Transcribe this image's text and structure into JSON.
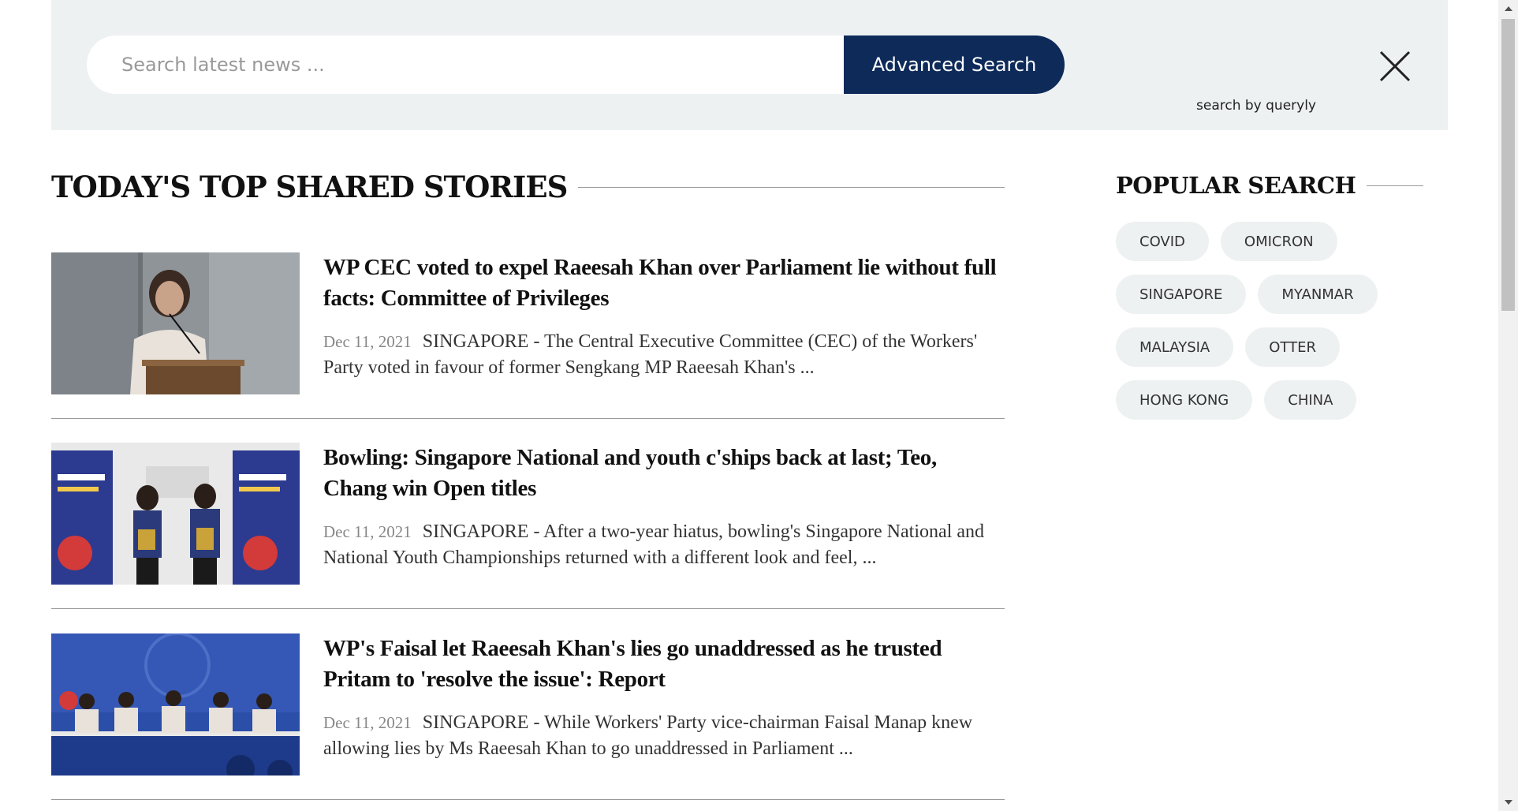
{
  "search": {
    "placeholder": "Search latest news ...",
    "button_label": "Advanced Search",
    "powered_by": "search by queryly"
  },
  "top_stories": {
    "heading": "TODAY'S TOP SHARED STORIES",
    "items": [
      {
        "headline": "WP CEC voted to expel Raeesah Khan over Parliament lie without full facts: Committee of Privileges",
        "date": "Dec 11, 2021",
        "summary": "SINGAPORE - The Central Executive Committee (CEC) of the Workers' Party voted in favour of former Sengkang MP Raeesah Khan's ..."
      },
      {
        "headline": "Bowling: Singapore National and youth c'ships back at last; Teo, Chang win Open titles",
        "date": "Dec 11, 2021",
        "summary": "SINGAPORE - After a two-year hiatus, bowling's Singapore National and National Youth Championships returned with a different look and feel, ..."
      },
      {
        "headline": "WP's Faisal let Raeesah Khan's lies go unaddressed as he trusted Pritam to 'resolve the issue': Report",
        "date": "Dec 11, 2021",
        "summary": "SINGAPORE - While Workers' Party vice-chairman Faisal Manap knew allowing lies by Ms Raeesah Khan to go unaddressed in Parliament ..."
      }
    ]
  },
  "popular_search": {
    "heading": "POPULAR SEARCH",
    "tags": [
      "COVID",
      "OMICRON",
      "SINGAPORE",
      "MYANMAR",
      "MALAYSIA",
      "OTTER",
      "HONG KONG",
      "CHINA"
    ]
  },
  "colors": {
    "search_band": "#eef1f2",
    "button_navy": "#0d2a59",
    "tag_bg": "#eef1f2"
  },
  "icons": {
    "close": "close-icon",
    "scroll_up": "chevron-up-icon",
    "scroll_down": "chevron-down-icon"
  }
}
